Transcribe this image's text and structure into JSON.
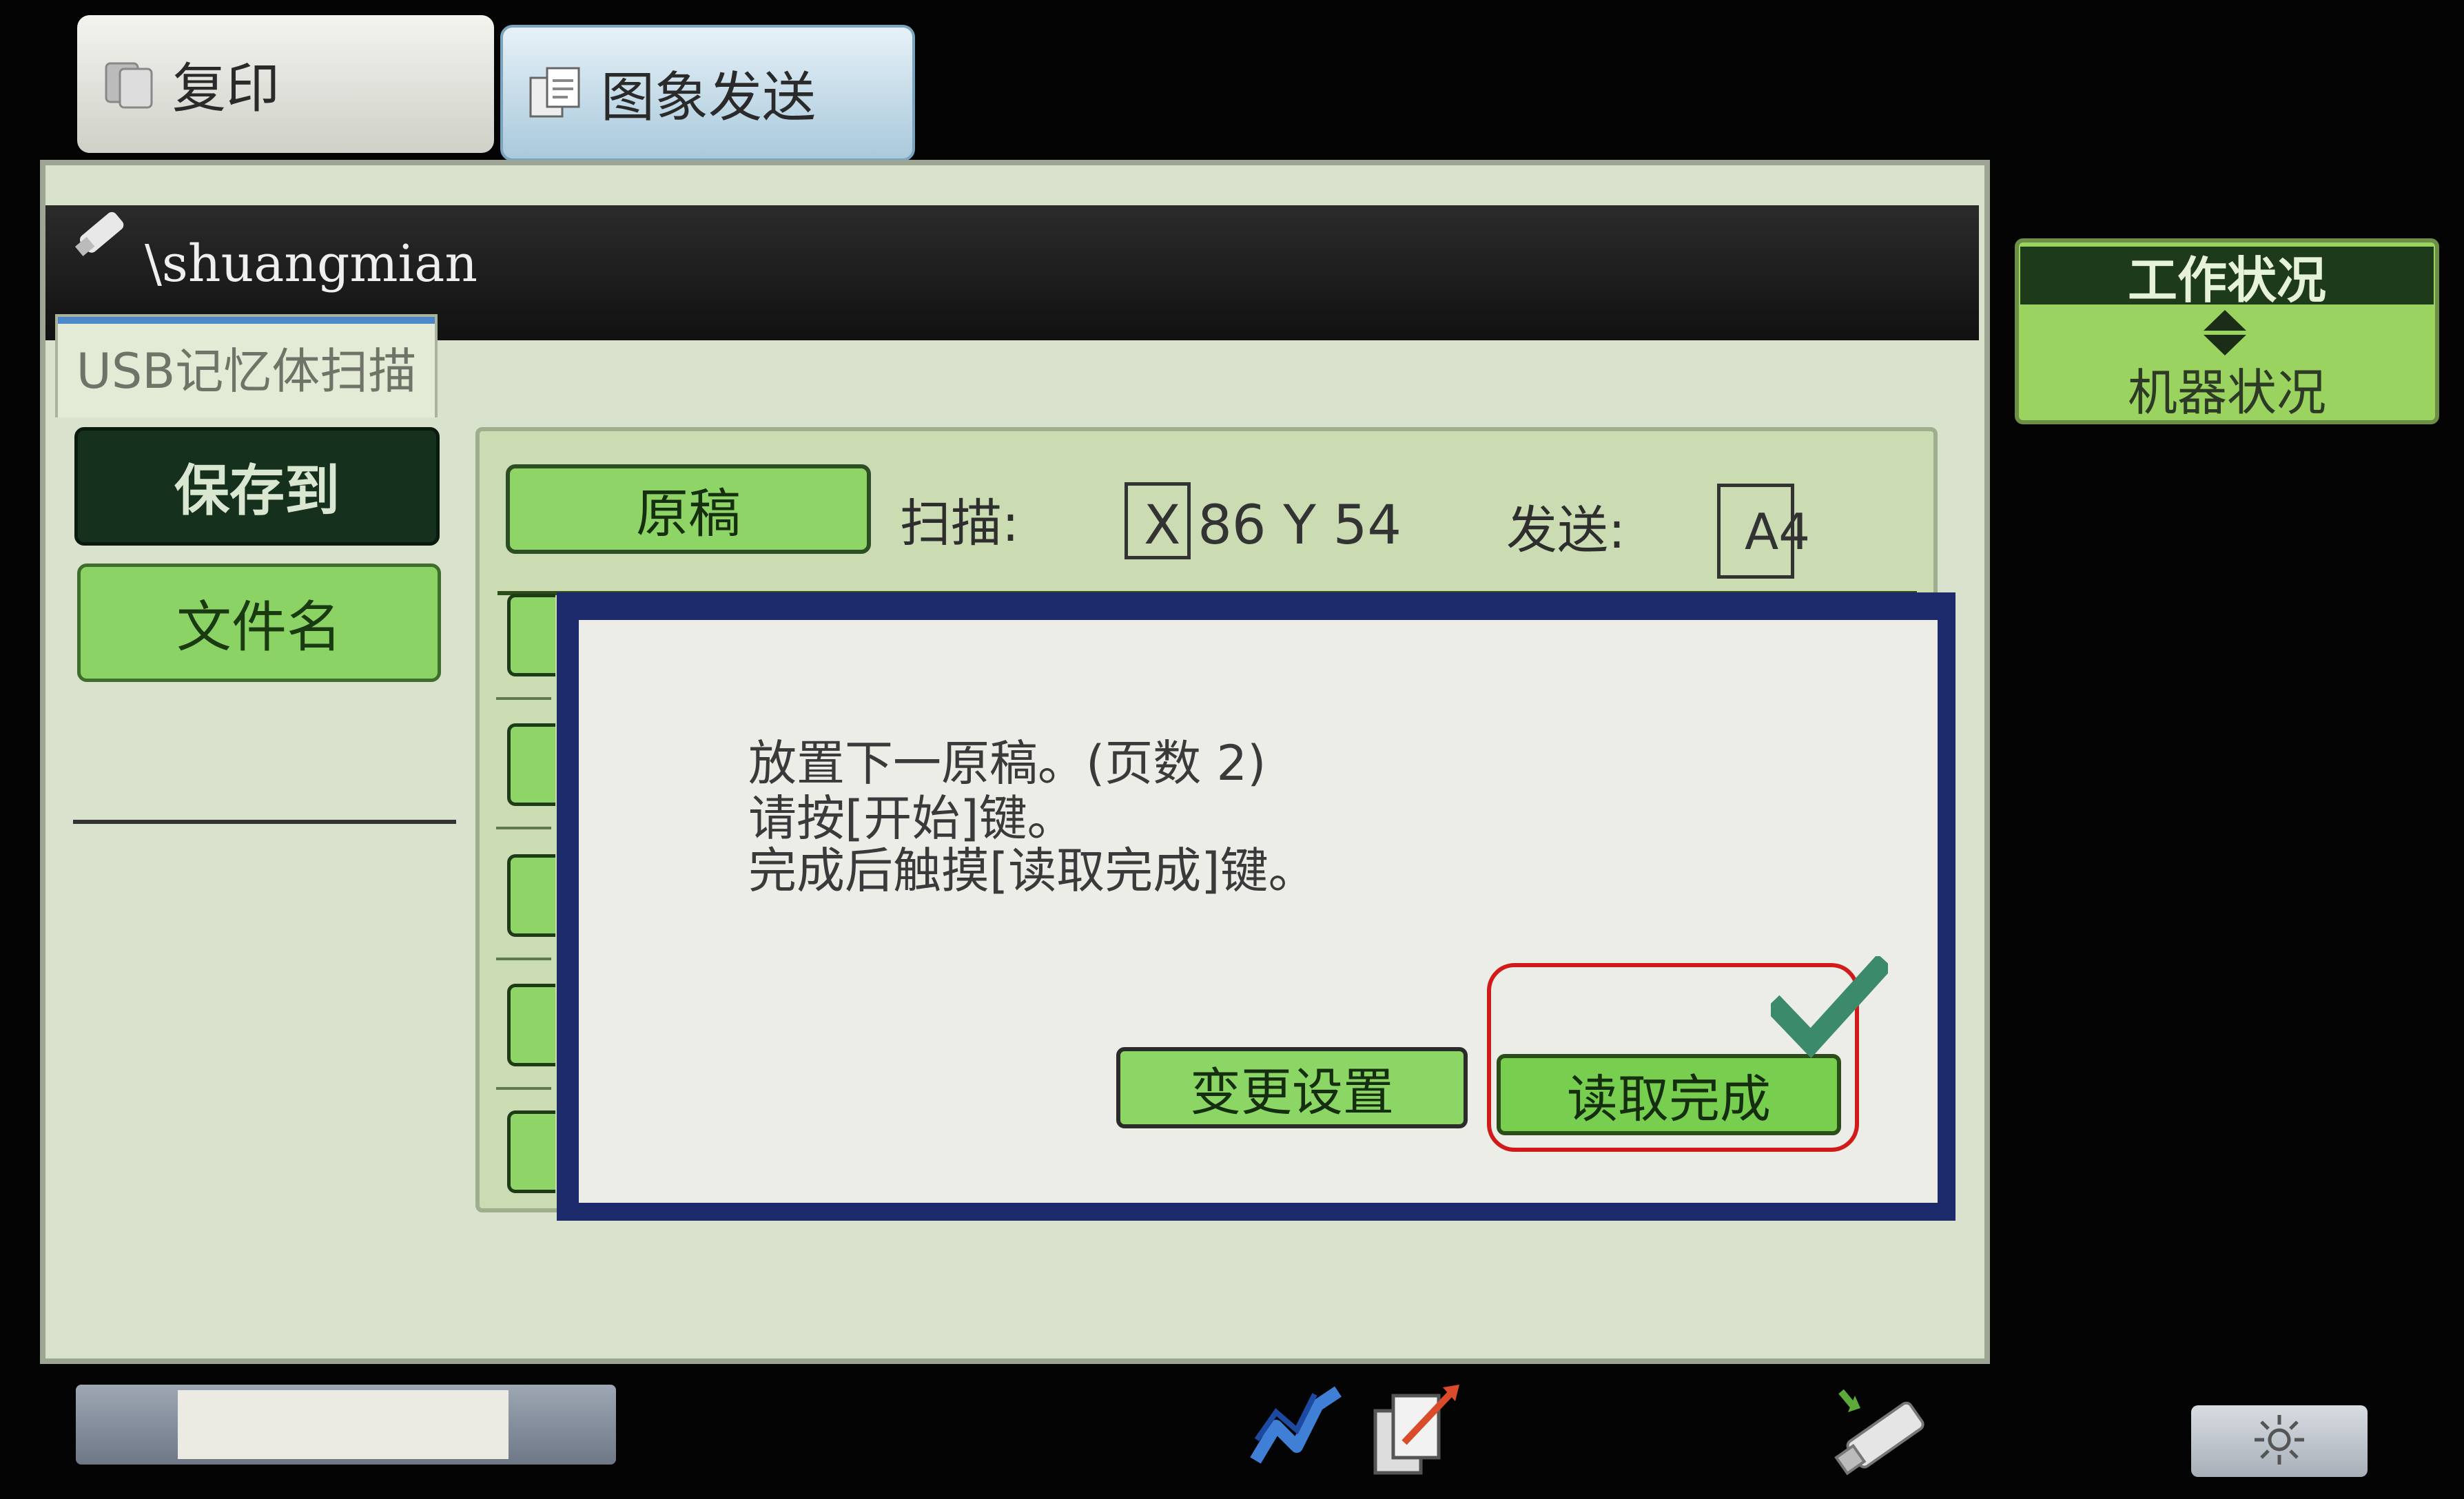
{
  "mode_tabs": {
    "copy": "复印",
    "image_send": "图象发送"
  },
  "title_bar": {
    "path": "\\shuangmian"
  },
  "usb_tab": "USB记忆体扫描",
  "sidebar": {
    "save_to": "保存到",
    "filename": "文件名"
  },
  "scan_info": {
    "original_button": "原稿",
    "scan_label": "扫描:",
    "scan_size": "X 86 Y 54",
    "send_label": "发送:",
    "send_size": "A4"
  },
  "dialog": {
    "line1": "放置下一原稿。(页数 2)",
    "line2": "请按[开始]键。",
    "line3": "完成后触摸[读取完成]键。",
    "change_settings": "变更设置",
    "read_complete": "读取完成"
  },
  "right_panel": {
    "job_status": "工作状况",
    "machine_status": "机器状况"
  },
  "colors": {
    "highlight_box": "#d11b1b",
    "checkmark": "#3a8a6b",
    "button_green": "#8bd664"
  }
}
